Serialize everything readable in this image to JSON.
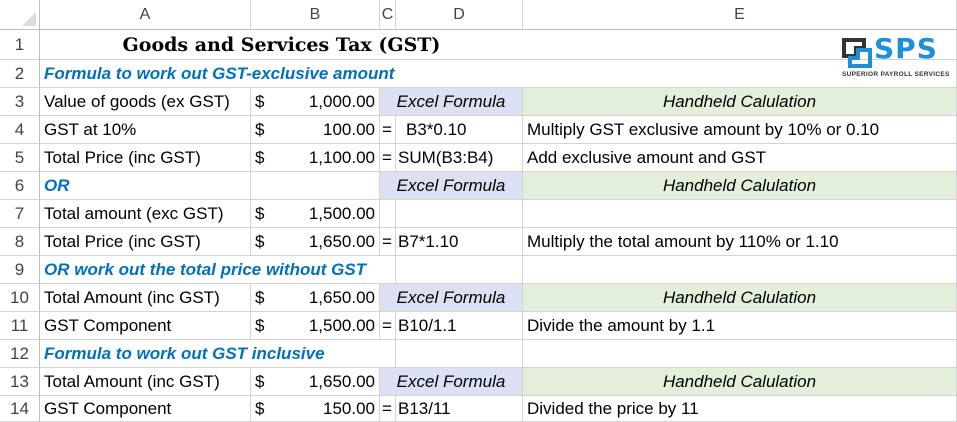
{
  "columns": [
    "A",
    "B",
    "C",
    "D",
    "E"
  ],
  "rows": [
    "1",
    "2",
    "3",
    "4",
    "5",
    "6",
    "7",
    "8",
    "9",
    "10",
    "11",
    "12",
    "13",
    "14"
  ],
  "title": "Goods and Services Tax (GST)",
  "logo": {
    "text": "SPS",
    "subtitle": "SUPERIOR PAYROLL SERVICES",
    "accent": "#1f8fd8"
  },
  "cells": {
    "A2": "Formula to work out GST-exclusive amount",
    "A3": "Value of goods (ex GST)",
    "B3s": "$",
    "B3v": "1,000.00",
    "D3": "Excel Formula",
    "E3": "Handheld Calulation",
    "A4": "GST at 10%",
    "B4s": "$",
    "B4v": "100.00",
    "C4": "=",
    "D4": "B3*0.10",
    "E4": "Multiply GST exclusive amount by 10% or 0.10",
    "A5": "Total Price (inc GST)",
    "B5s": "$",
    "B5v": "1,100.00",
    "C5": "=",
    "D5": "SUM(B3:B4)",
    "E5": "Add exclusive amount and GST",
    "A6": "OR",
    "D6": "Excel Formula",
    "E6": "Handheld Calulation",
    "A7": "Total amount (exc GST)",
    "B7s": "$",
    "B7v": "1,500.00",
    "A8": "Total Price (inc GST)",
    "B8s": "$",
    "B8v": "1,650.00",
    "C8": "=",
    "D8": "B7*1.10",
    "E8": "Multiply the total amount by 110% or 1.10",
    "A9": "OR work out the total price without GST",
    "A10": "Total Amount (inc GST)",
    "B10s": "$",
    "B10v": "1,650.00",
    "D10": "Excel Formula",
    "E10": "Handheld Calulation",
    "A11": "GST Component",
    "B11s": "$",
    "B11v": "1,500.00",
    "C11": "=",
    "D11": "B10/1.1",
    "E11": "Divide the amount by 1.1",
    "A12": "Formula to work out GST inclusive",
    "A13": "Total Amount (inc GST)",
    "B13s": "$",
    "B13v": "1,650.00",
    "D13": "Excel Formula",
    "E13": "Handheld Calulation",
    "A14": "GST Component",
    "B14s": "$",
    "B14v": "150.00",
    "C14": "=",
    "D14": "B13/11",
    "E14": "Divided the price by 11"
  }
}
